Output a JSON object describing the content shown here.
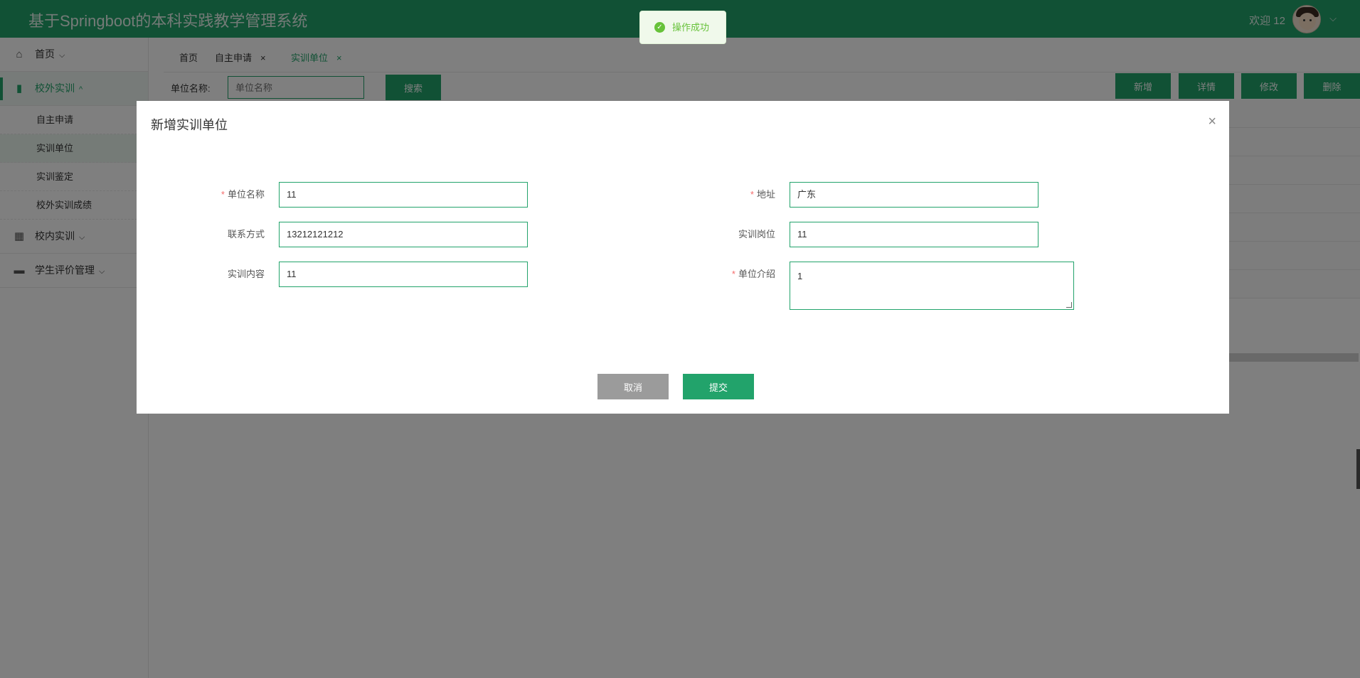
{
  "app": {
    "title": "基于Springboot的本科实践教学管理系统",
    "welcome": "欢迎 12"
  },
  "sidebar": {
    "items": [
      {
        "label": "首页",
        "icon": "home-icon"
      },
      {
        "label": "校外实训",
        "icon": "book-icon"
      },
      {
        "label": "校内实训",
        "icon": "table-icon"
      },
      {
        "label": "学生评价管理",
        "icon": "box-icon"
      }
    ],
    "subitems": [
      "自主申请",
      "实训单位",
      "实训鉴定",
      "校外实训成绩"
    ]
  },
  "tabs": [
    "首页",
    "自主申请",
    "实训单位"
  ],
  "toolbar": {
    "filter_label": "单位名称:",
    "filter_placeholder": "单位名称",
    "search": "搜索",
    "add": "新增",
    "detail": "详情",
    "edit": "修改",
    "delete": "删除"
  },
  "toast": {
    "text": "操作成功"
  },
  "dialog": {
    "title": "新增实训单位",
    "fields": {
      "unit_name": {
        "label": "单位名称",
        "value": "11"
      },
      "address": {
        "label": "地址",
        "value": "广东"
      },
      "contact": {
        "label": "联系方式",
        "value": "13212121212"
      },
      "position": {
        "label": "实训岗位",
        "value": "11"
      },
      "content": {
        "label": "实训内容",
        "value": "11"
      },
      "intro": {
        "label": "单位介绍",
        "value": "1"
      }
    },
    "cancel": "取消",
    "submit": "提交"
  },
  "colors": {
    "primary": "#22a36b",
    "toast_success": "#67c23a"
  }
}
